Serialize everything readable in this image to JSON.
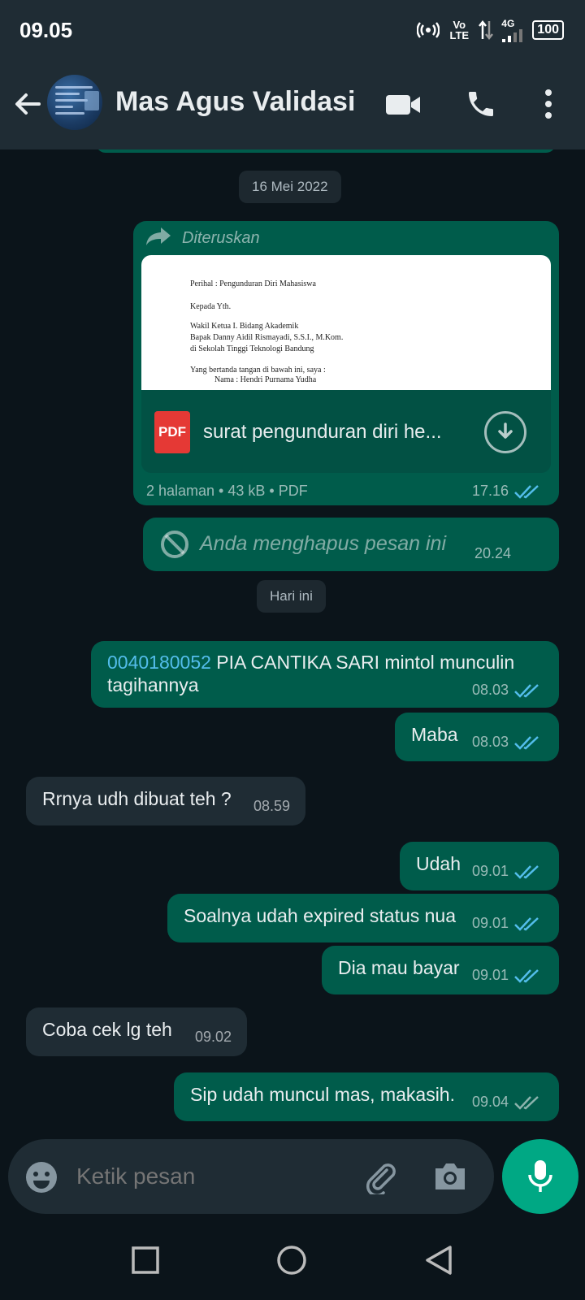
{
  "status_bar": {
    "time": "09.05",
    "volte": "Vo LTE",
    "network": "4G",
    "battery": "100"
  },
  "header": {
    "contact_name": "Mas Agus Validasi",
    "icons": [
      "back-arrow-icon",
      "video-call-icon",
      "phone-icon",
      "more-vert-icon"
    ]
  },
  "date_separators": {
    "first": "16 Mei 2022",
    "second": "Hari ini"
  },
  "forwarded_doc": {
    "forwarded_label": "Diteruskan",
    "preview_lines": [
      "Perihal          : Pengunduran Diri Mahasiswa",
      "Kepada Yth.",
      "Wakil Ketua I. Bidang Akademik",
      "Bapak Danny Aidil Rismayadi, S.S.I., M.Kom.",
      "di Sekolah Tinggi Teknologi Bandung",
      "Yang bertanda tangan di bawah ini, saya :",
      "Nama            : Hendri Purnama Yudha"
    ],
    "file_name": "surat pengunduran diri he...",
    "file_info": "2 halaman • 43 kB • PDF",
    "time": "17.16",
    "pdf_badge": "PDF"
  },
  "deleted_message": {
    "text": "Anda menghapus pesan ini",
    "time": "20.24"
  },
  "messages": [
    {
      "dir": "out",
      "link": "0040180052",
      "text": " PIA CANTIKA SARI mintol munculin tagihannya",
      "time": "08.03",
      "read": true
    },
    {
      "dir": "out",
      "text": "Maba",
      "time": "08.03",
      "read": true
    },
    {
      "dir": "in",
      "text": "Rrnya udh dibuat teh ?",
      "time": "08.59"
    },
    {
      "dir": "out",
      "text": "Udah",
      "time": "09.01",
      "read": true
    },
    {
      "dir": "out",
      "text": "Soalnya udah expired status nua",
      "time": "09.01",
      "read": true
    },
    {
      "dir": "out",
      "text": "Dia mau bayar",
      "time": "09.01",
      "read": true
    },
    {
      "dir": "in",
      "text": "Coba cek lg teh",
      "time": "09.02"
    },
    {
      "dir": "out",
      "text": "Sip udah muncul mas, makasih.",
      "time": "09.04",
      "read": false
    }
  ],
  "composer": {
    "placeholder": "Ketik pesan"
  },
  "colors": {
    "outgoing_bubble": "#005c4b",
    "incoming_bubble": "#1f2c34",
    "read_ticks": "#53bdeb",
    "accent": "#00a884"
  }
}
